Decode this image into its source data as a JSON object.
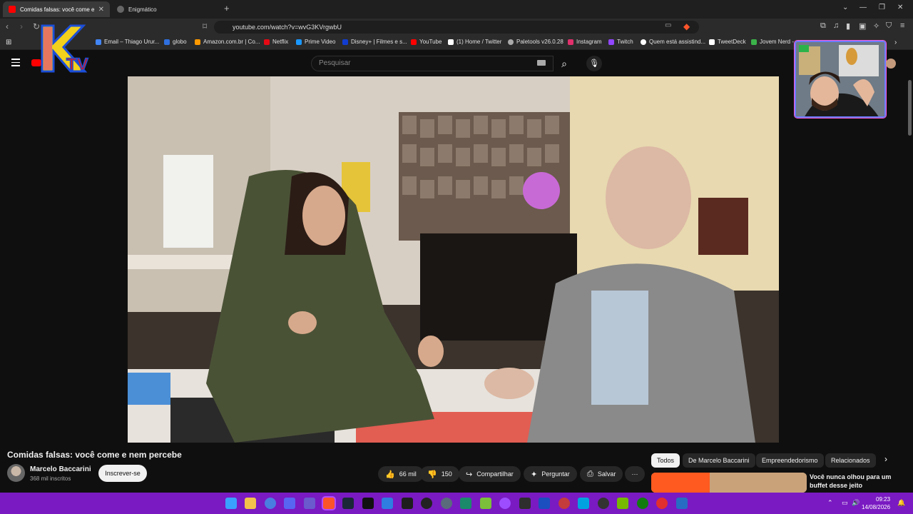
{
  "browser": {
    "tabs": [
      {
        "label": "Comidas falsas: você come e",
        "active": true
      },
      {
        "label": "Enigmático",
        "active": false
      }
    ],
    "new_tab": "+",
    "url": "youtube.com/watch?v=wvG3KVrgwbU",
    "bookmarks": [
      {
        "label": "Email – Thiago Urur...",
        "color": "#4285f4"
      },
      {
        "label": "globo",
        "color": "#2f6fde"
      },
      {
        "label": "Amazon.com.br | Co...",
        "color": "#ff9900"
      },
      {
        "label": "Netflix",
        "color": "#e50914"
      },
      {
        "label": "Prime Video",
        "color": "#1a98ff"
      },
      {
        "label": "Disney+ | Filmes e s...",
        "color": "#113ccf"
      },
      {
        "label": "YouTube",
        "color": "#ff0000"
      },
      {
        "label": "(1) Home / Twitter",
        "color": "#ffffff"
      },
      {
        "label": "Paletools v26.0.28",
        "color": "#aaaaaa"
      },
      {
        "label": "Instagram",
        "color": "#e1306c"
      },
      {
        "label": "Twitch",
        "color": "#9146ff"
      },
      {
        "label": "Quem está assistind...",
        "color": "#ffffff"
      },
      {
        "label": "TweetDeck",
        "color": "#ffffff"
      },
      {
        "label": "Jovem Nerd -",
        "color": "#3bb34a"
      }
    ]
  },
  "youtube": {
    "search_placeholder": "Pesquisar",
    "video_title": "Comidas falsas: você come e nem percebe",
    "channel_name": "Marcelo Baccarini",
    "subscribers": "368 mil inscritos",
    "subscribe_label": "Inscrever-se",
    "likes": "66 mil",
    "dislikes": "150",
    "share_label": "Compartilhar",
    "ask_label": "Perguntar",
    "save_label": "Salvar",
    "more_label": "···",
    "chips": [
      "Todos",
      "De Marcelo Baccarini",
      "Empreendedorismo",
      "Relacionados"
    ],
    "rec_title": "Você nunca olhou para um buffet desse jeito"
  },
  "overlay": {
    "logo_text": "KTV"
  },
  "taskbar": {
    "time": "09:23",
    "date": "14/08/2026"
  },
  "colors": {
    "accent": "#ff0000",
    "taskbar": "#7a1ac2"
  }
}
